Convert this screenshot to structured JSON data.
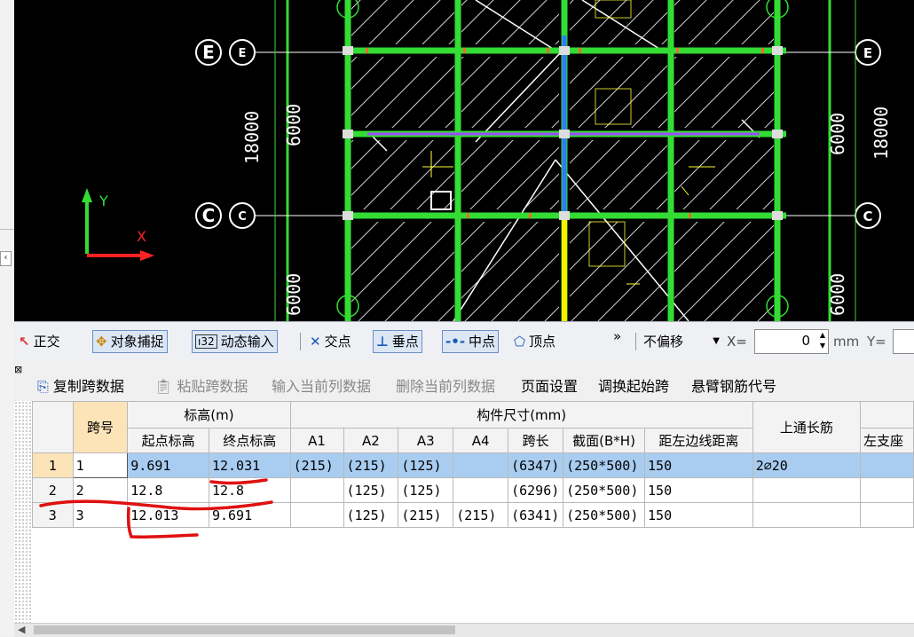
{
  "cad": {
    "axis_labels": {
      "e_left": "E",
      "e_small": "E",
      "c_left": "C",
      "c_small": "C",
      "e_right": "E",
      "c_right": "C"
    },
    "dims": {
      "d18000_left": "18000",
      "d6000_left_top": "6000",
      "d6000_left_bottom": "6000",
      "d6000_right_top": "6000",
      "d18000_right": "18000",
      "d6000_right_bottom": "6000"
    },
    "ucs": {
      "x": "X",
      "y": "Y"
    }
  },
  "toolbar": {
    "ortho": "正交",
    "snap": "对象捕捉",
    "dyn_input": "动态输入",
    "intersect": "交点",
    "perp": "垂点",
    "mid": "中点",
    "vertex": "顶点",
    "more": "»",
    "offset_select": "不偏移",
    "x_label": "X=",
    "x_value": "0",
    "mm_label": "mm",
    "y_label": "Y="
  },
  "pane": {
    "copy": "复制跨数据",
    "paste": "粘贴跨数据",
    "input_col": "输入当前列数据",
    "delete_col": "删除当前列数据",
    "page_setup": "页面设置",
    "swap_start": "调换起始跨",
    "cantilever": "悬臂钢筋代号"
  },
  "grid": {
    "h_span": "跨号",
    "h_elev": "标高(m)",
    "h_start": "起点标高",
    "h_end": "终点标高",
    "h_size": "构件尺寸(mm)",
    "h_a1": "A1",
    "h_a2": "A2",
    "h_a3": "A3",
    "h_a4": "A4",
    "h_len": "跨长",
    "h_sec": "截面(B*H)",
    "h_dist": "距左边线距离",
    "h_top": "上通长筋",
    "h_left": "左支座",
    "rows": [
      {
        "n": "1",
        "span": "1",
        "start": "9.691",
        "end": "12.031",
        "a1": "(215)",
        "a2": "(215)",
        "a3": "(125)",
        "a4": "",
        "len": "(6347)",
        "sec": "(250*500)",
        "dist": "150",
        "top": "2⌀20"
      },
      {
        "n": "2",
        "span": "2",
        "start": "12.8",
        "end": "12.8",
        "a1": "",
        "a2": "(125)",
        "a3": "(125)",
        "a4": "",
        "len": "(6296)",
        "sec": "(250*500)",
        "dist": "150",
        "top": ""
      },
      {
        "n": "3",
        "span": "3",
        "start": "12.013",
        "end": "9.691",
        "a1": "",
        "a2": "(125)",
        "a3": "(215)",
        "a4": "(215)",
        "len": "(6341)",
        "sec": "(250*500)",
        "dist": "150",
        "top": ""
      }
    ]
  },
  "colors": {
    "beam_green": "#33dd33",
    "selected_row": "#a9cdf1",
    "annotation_red": "#e01010"
  }
}
